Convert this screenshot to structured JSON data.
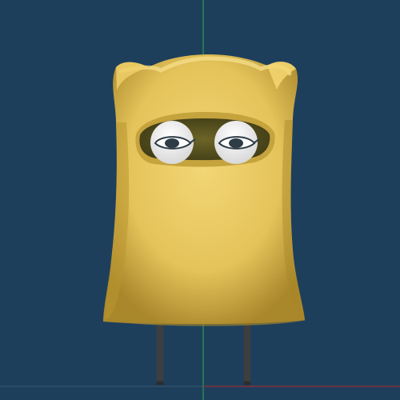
{
  "viewport": {
    "background_color": "#1e3f5c",
    "axes": {
      "y_axis_color": "#2fa84f",
      "x_axis_color": "#b52a2a",
      "origin_color": "#6b6b6b"
    }
  },
  "model": {
    "description_tag": "yellow-hooded-character",
    "body_color": "#e7c95a",
    "shadow_color": "#b79631",
    "highlight_color": "#f5df83",
    "eye_hole_color": "#5e5723",
    "eye_color": "#e9e9e9",
    "pupil_color": "#2d3b44",
    "leg_color": "#3d3d3d"
  }
}
